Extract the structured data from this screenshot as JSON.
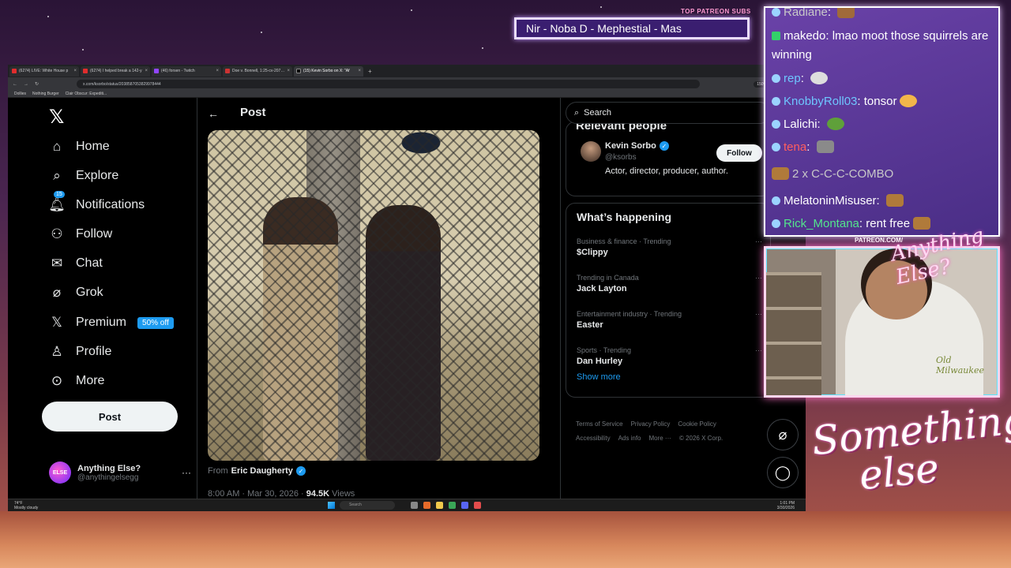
{
  "overlay": {
    "top_patreon_label": "TOP PATREON SUBS",
    "patreon_names": "Nir - Noba D - Mephestial - Mas",
    "patreon_url": "PATREON.COM/",
    "logo_text": "Anything Else?",
    "brand_script_line1": "Something",
    "brand_script_line2": "else",
    "chat": [
      {
        "user": "Radiane",
        "message": "",
        "user_color": "#c8c8c8",
        "badge": "dot"
      },
      {
        "user": "makedo",
        "message": "lmao moot those squirrels are winning",
        "user_color": "#ffffff",
        "badge": "square"
      },
      {
        "user": "rep",
        "message": "",
        "user_color": "#6ec6ff",
        "badge": "dot"
      },
      {
        "user": "KnobbyRoll03",
        "message": "tonsor",
        "user_color": "#6ec6ff",
        "badge": "dot"
      },
      {
        "user": "Lalichi",
        "message": "",
        "user_color": "#ffffff",
        "badge": "dot"
      },
      {
        "user": "tena",
        "message": "",
        "user_color": "#ff5e5e",
        "badge": "dot"
      },
      {
        "user": "2 x C-C-C-COMBO",
        "message": "",
        "user_color": "#c8c8c8",
        "badge": "emote"
      },
      {
        "user": "MelatoninMisuser",
        "message": "",
        "user_color": "#ffffff",
        "badge": "dot"
      },
      {
        "user": "Rick_Montana",
        "message": "rent free",
        "user_color": "#53e58c",
        "badge": "dot"
      }
    ],
    "cam_shirt_text": "Old Milwaukee"
  },
  "browser": {
    "tabs": [
      {
        "label": "(6274) LIVE: White House p",
        "icon": "youtube-icon"
      },
      {
        "label": "(6274) I helped break a 142-y",
        "icon": "youtube-icon"
      },
      {
        "label": "(46) forsen - Twitch",
        "icon": "twitch-icon"
      },
      {
        "label": "Doe v. Bonnell, 1:25-cv-20757",
        "icon": "document-icon"
      },
      {
        "label": "(15) Kevin Sorbo on X: \"Af",
        "icon": "x-icon",
        "active": true
      }
    ],
    "url": "x.com/ksorbo/status/2038587053829978444",
    "zoom": "150%",
    "bookmarks": [
      "Dollies",
      "Nothing Burger",
      "Clair Obscur: Expediti..."
    ]
  },
  "xnav": {
    "items": [
      {
        "label": "Home",
        "icon": "home-icon"
      },
      {
        "label": "Explore",
        "icon": "search-icon"
      },
      {
        "label": "Notifications",
        "icon": "bell-icon",
        "badge": "15"
      },
      {
        "label": "Follow",
        "icon": "add-person-icon"
      },
      {
        "label": "Chat",
        "icon": "mail-icon"
      },
      {
        "label": "Grok",
        "icon": "grok-icon"
      },
      {
        "label": "Premium",
        "icon": "x-logo-icon",
        "badge": "50% off"
      },
      {
        "label": "Profile",
        "icon": "person-icon"
      },
      {
        "label": "More",
        "icon": "more-circle-icon"
      }
    ],
    "post_button": "Post",
    "account": {
      "name": "Anything Else?",
      "handle": "@anythingelsegg",
      "avatar_text": "ELSE"
    }
  },
  "post": {
    "header": "Post",
    "from_label": "From",
    "from_name": "Eric Daugherty",
    "date": "8:00 AM · Mar 30, 2026 ·",
    "views_count": "94.5K",
    "views_label": "Views"
  },
  "sidebar": {
    "search_placeholder": "Search",
    "relevant_title": "Relevant people",
    "person": {
      "name": "Kevin Sorbo",
      "handle": "@ksorbs",
      "bio": "Actor, director, producer, author.",
      "follow": "Follow"
    },
    "happening_title": "What’s happening",
    "trends": [
      {
        "context": "Business & finance · Trending",
        "name": "$Clippy"
      },
      {
        "context": "Trending in Canada",
        "name": "Jack Layton"
      },
      {
        "context": "Entertainment industry · Trending",
        "name": "Easter"
      },
      {
        "context": "Sports · Trending",
        "name": "Dan Hurley"
      }
    ],
    "show_more": "Show more",
    "footer": [
      "Terms of Service",
      "Privacy Policy",
      "Cookie Policy",
      "Accessibility",
      "Ads info",
      "More ···",
      "© 2026 X Corp."
    ]
  },
  "taskbar": {
    "weather_temp": "74°F",
    "weather_desc": "Mostly cloudy",
    "search": "Search",
    "time": "1:01 PM",
    "date": "3/30/2026"
  },
  "colors": {
    "accent": "#1d9bf0",
    "chat_bg": "#5a36a0",
    "page_bg": "#000000"
  }
}
